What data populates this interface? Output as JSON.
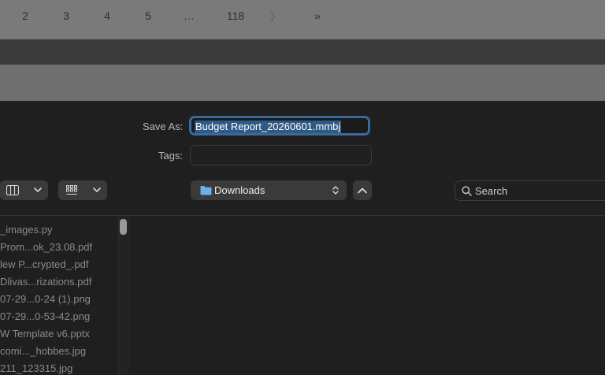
{
  "pagination": {
    "pages": [
      "2",
      "3",
      "4",
      "5",
      "…",
      "118"
    ],
    "next": "〉",
    "last": "»"
  },
  "dialog": {
    "save_as_label": "Save As:",
    "save_as_value": "Budget Report_20260601.mmbj",
    "tags_label": "Tags:",
    "tags_value": "",
    "location": "Downloads",
    "search_placeholder": "Search",
    "files": [
      "_images.py",
      "Prom...ok_23.08.pdf",
      "lew P...crypted_.pdf",
      "Dlivas...rizations.pdf",
      "07-29...0-24 (1).png",
      "07-29...0-53-42.png",
      "W Template v6.pptx",
      "comi..._hobbes.jpg",
      "211_123315.jpg"
    ]
  },
  "colors": {
    "accent": "#3a6a9a",
    "selection": "#2f5a85",
    "folder": "#6fb0e8"
  }
}
